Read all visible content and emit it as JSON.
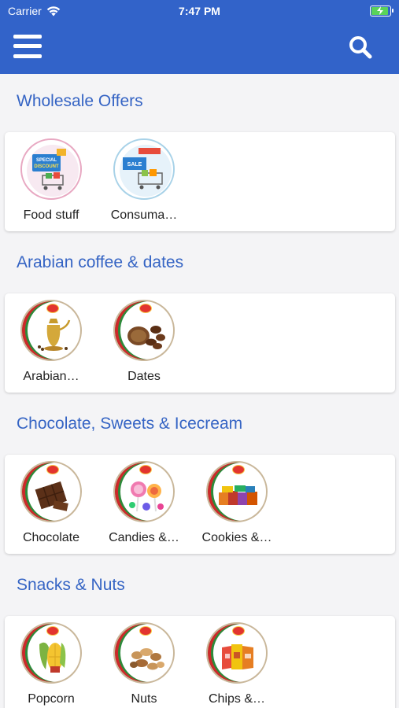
{
  "status_bar": {
    "carrier": "Carrier",
    "time": "7:47 PM"
  },
  "header": {
    "menu_icon": "hamburger-menu-icon",
    "search_icon": "search-icon"
  },
  "sections": [
    {
      "title": "Wholesale Offers",
      "items": [
        {
          "label": "Food stuff",
          "icon": "food-stuff-discount-icon"
        },
        {
          "label": "Consuma…",
          "icon": "consumables-sale-icon"
        }
      ]
    },
    {
      "title": "Arabian coffee & dates",
      "items": [
        {
          "label": "Arabian…",
          "icon": "arabian-coffee-pot-icon"
        },
        {
          "label": "Dates",
          "icon": "dates-icon"
        }
      ]
    },
    {
      "title": "Chocolate, Sweets & Icecream",
      "items": [
        {
          "label": "Chocolate",
          "icon": "chocolate-icon"
        },
        {
          "label": "Candies &…",
          "icon": "candies-icon"
        },
        {
          "label": "Cookies &…",
          "icon": "cookies-icon"
        }
      ]
    },
    {
      "title": "Snacks & Nuts",
      "items": [
        {
          "label": "Popcorn",
          "icon": "popcorn-icon"
        },
        {
          "label": "Nuts",
          "icon": "nuts-icon"
        },
        {
          "label": "Chips &…",
          "icon": "chips-icon"
        }
      ]
    }
  ],
  "colors": {
    "header": "#3263c9",
    "section_title": "#3564c4",
    "background": "#f4f4f6"
  }
}
